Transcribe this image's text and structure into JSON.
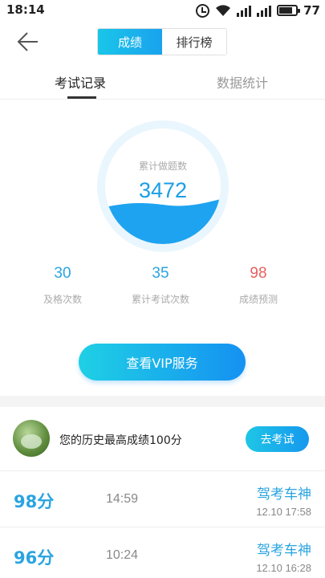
{
  "status": {
    "time": "18:14",
    "battery": "77"
  },
  "header": {
    "seg_active": "成绩",
    "seg_inactive": "排行榜"
  },
  "tabs": {
    "records": "考试记录",
    "stats": "数据统计"
  },
  "circle": {
    "label": "累计做题数",
    "value": "3472"
  },
  "stats": [
    {
      "value": "30",
      "label": "及格次数"
    },
    {
      "value": "35",
      "label": "累计考试次数"
    },
    {
      "value": "98",
      "label": "成绩预测"
    }
  ],
  "vip_button": "查看VIP服务",
  "best": {
    "text": "您的历史最高成绩100分",
    "button": "去考试"
  },
  "records": [
    {
      "score": "98分",
      "duration": "14:59",
      "title": "驾考车神",
      "date": "12.10  17:58"
    },
    {
      "score": "96分",
      "duration": "10:24",
      "title": "驾考车神",
      "date": "12.10  16:28"
    }
  ],
  "colors": {
    "accent": "#1a9ee6",
    "prediction": "#e8605e"
  }
}
